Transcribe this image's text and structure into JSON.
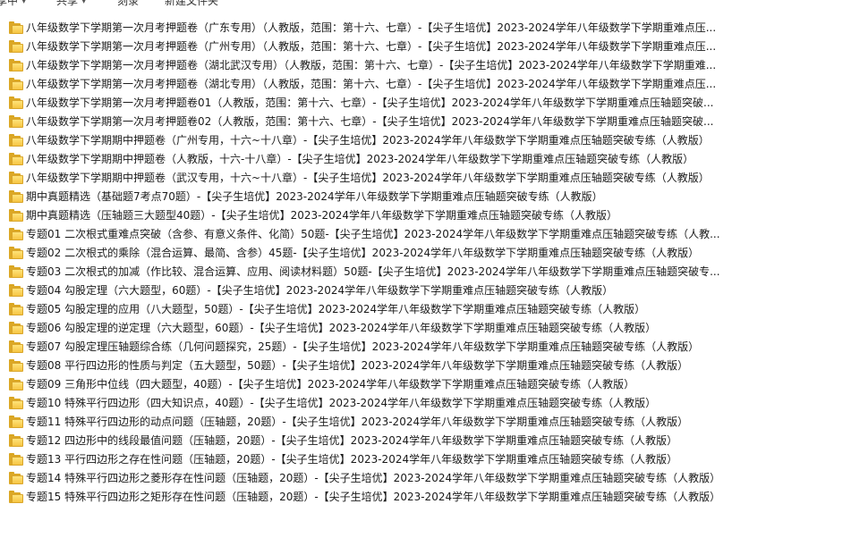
{
  "toolbar": {
    "items": [
      {
        "label": "享中",
        "has_dropdown": true
      },
      {
        "label": "共享",
        "has_dropdown": true
      },
      {
        "label": "刻录",
        "has_dropdown": false
      },
      {
        "label": "新建文件夹",
        "has_dropdown": false
      }
    ]
  },
  "icons": {
    "folder": "folder-icon",
    "dropdown": "chevron-down-icon"
  },
  "colors": {
    "folder": "#f6c543",
    "hover": "#e5f3ff",
    "text": "#1a1a1a"
  },
  "files": [
    {
      "name": "八年级数学下学期第一次月考押题卷（广东专用）（人教版，范围：第十六、七章）-【尖子生培优】2023-2024学年八年级数学下学期重难点压..."
    },
    {
      "name": "八年级数学下学期第一次月考押题卷（广州专用）（人教版，范围：第十六、七章）-【尖子生培优】2023-2024学年八年级数学下学期重难点压..."
    },
    {
      "name": "八年级数学下学期第一次月考押题卷（湖北武汉专用）（人教版，范围：第十六、七章）-【尖子生培优】2023-2024学年八年级数学下学期重难..."
    },
    {
      "name": "八年级数学下学期第一次月考押题卷（湖北专用）（人教版，范围：第十六、七章）-【尖子生培优】2023-2024学年八年级数学下学期重难点压..."
    },
    {
      "name": "八年级数学下学期第一次月考押题卷01（人教版，范围：第十六、七章）-【尖子生培优】2023-2024学年八年级数学下学期重难点压轴题突破..."
    },
    {
      "name": "八年级数学下学期第一次月考押题卷02（人教版，范围：第十六、七章）-【尖子生培优】2023-2024学年八年级数学下学期重难点压轴题突破..."
    },
    {
      "name": "八年级数学下学期期中押题卷（广州专用，十六~十八章）-【尖子生培优】2023-2024学年八年级数学下学期重难点压轴题突破专练（人教版）"
    },
    {
      "name": "八年级数学下学期期中押题卷（人教版，十六-十八章）-【尖子生培优】2023-2024学年八年级数学下学期重难点压轴题突破专练（人教版）"
    },
    {
      "name": "八年级数学下学期期中押题卷（武汉专用，十六~十八章）-【尖子生培优】2023-2024学年八年级数学下学期重难点压轴题突破专练（人教版）"
    },
    {
      "name": "期中真题精选（基础题7考点70题）-【尖子生培优】2023-2024学年八年级数学下学期重难点压轴题突破专练（人教版）"
    },
    {
      "name": "期中真题精选（压轴题三大题型40题）-【尖子生培优】2023-2024学年八年级数学下学期重难点压轴题突破专练（人教版）"
    },
    {
      "name": "专题01 二次根式重难点突破（含参、有意义条件、化简）50题-【尖子生培优】2023-2024学年八年级数学下学期重难点压轴题突破专练（人教..."
    },
    {
      "name": "专题02 二次根式的乘除（混合运算、最简、含参）45题-【尖子生培优】2023-2024学年八年级数学下学期重难点压轴题突破专练（人教版）"
    },
    {
      "name": "专题03 二次根式的加减（作比较、混合运算、应用、阅读材料题）50题-【尖子生培优】2023-2024学年八年级数学下学期重难点压轴题突破专..."
    },
    {
      "name": "专题04 勾股定理（六大题型，60题）-【尖子生培优】2023-2024学年八年级数学下学期重难点压轴题突破专练（人教版）"
    },
    {
      "name": "专题05 勾股定理的应用（八大题型，50题）-【尖子生培优】2023-2024学年八年级数学下学期重难点压轴题突破专练（人教版）"
    },
    {
      "name": "专题06 勾股定理的逆定理（六大题型，60题）-【尖子生培优】2023-2024学年八年级数学下学期重难点压轴题突破专练（人教版）"
    },
    {
      "name": "专题07 勾股定理压轴题综合练（几何问题探究，25题）-【尖子生培优】2023-2024学年八年级数学下学期重难点压轴题突破专练（人教版）"
    },
    {
      "name": "专题08 平行四边形的性质与判定（五大题型，50题）-【尖子生培优】2023-2024学年八年级数学下学期重难点压轴题突破专练（人教版）"
    },
    {
      "name": "专题09 三角形中位线（四大题型，40题）-【尖子生培优】2023-2024学年八年级数学下学期重难点压轴题突破专练（人教版）"
    },
    {
      "name": "专题10 特殊平行四边形（四大知识点，40题）-【尖子生培优】2023-2024学年八年级数学下学期重难点压轴题突破专练（人教版）"
    },
    {
      "name": "专题11 特殊平行四边形的动点问题（压轴题，20题）-【尖子生培优】2023-2024学年八年级数学下学期重难点压轴题突破专练（人教版）"
    },
    {
      "name": "专题12 四边形中的线段最值问题（压轴题，20题）-【尖子生培优】2023-2024学年八年级数学下学期重难点压轴题突破专练（人教版）"
    },
    {
      "name": "专题13 平行四边形之存在性问题（压轴题，20题）-【尖子生培优】2023-2024学年八年级数学下学期重难点压轴题突破专练（人教版）"
    },
    {
      "name": "专题14 特殊平行四边形之菱形存在性问题（压轴题，20题）-【尖子生培优】2023-2024学年八年级数学下学期重难点压轴题突破专练（人教版）"
    },
    {
      "name": "专题15 特殊平行四边形之矩形存在性问题（压轴题，20题）-【尖子生培优】2023-2024学年八年级数学下学期重难点压轴题突破专练（人教版）"
    }
  ]
}
